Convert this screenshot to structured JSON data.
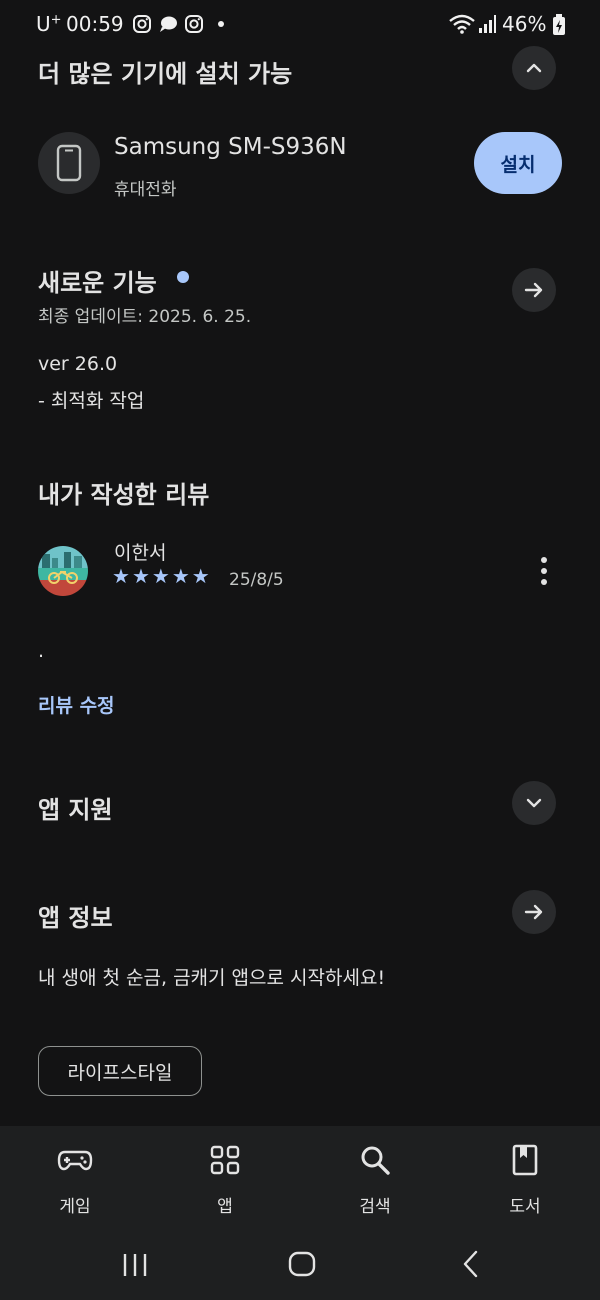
{
  "status_bar": {
    "carrier": "U",
    "carrier_plus": "+",
    "time": "00:59",
    "battery": "46%"
  },
  "devices": {
    "title": "더 많은 기기에 설치 가능",
    "device_name": "Samsung SM-S936N",
    "device_type": "휴대전화",
    "install_label": "설치"
  },
  "whats_new": {
    "title": "새로운 기능",
    "updated": "최종 업데이트: 2025. 6. 25.",
    "version": "ver 26.0",
    "notes": "- 최적화 작업"
  },
  "my_review": {
    "title": "내가 작성한 리뷰",
    "author": "이한서",
    "rating": 5,
    "stars": [
      "★",
      "★",
      "★",
      "★",
      "★"
    ],
    "date": "25/8/5",
    "text": ".",
    "edit_label": "리뷰 수정"
  },
  "app_support": {
    "title": "앱 지원"
  },
  "app_info": {
    "title": "앱 정보",
    "description": "내 생애 첫 순금, 금캐기 앱으로 시작하세요!",
    "category": "라이프스타일"
  },
  "bottom_nav": {
    "items": [
      {
        "label": "게임",
        "icon": "gamepad-icon"
      },
      {
        "label": "앱",
        "icon": "apps-grid-icon"
      },
      {
        "label": "검색",
        "icon": "search-icon"
      },
      {
        "label": "도서",
        "icon": "book-icon"
      }
    ]
  },
  "colors": {
    "background": "#131314",
    "accent": "#a8c7fa",
    "button_surface": "#2a2b2d"
  }
}
